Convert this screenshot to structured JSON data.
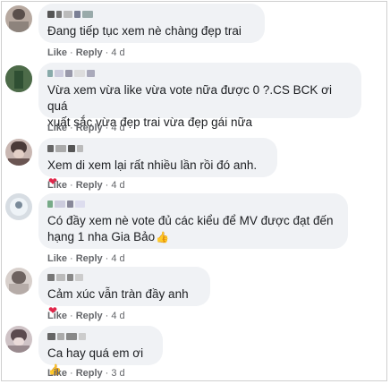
{
  "comments": [
    {
      "text": "Đang tiếp tục xem nè chàng đẹp trai",
      "emoji": "",
      "actions": {
        "like": "Like",
        "reply": "Reply",
        "time": "4 d"
      }
    },
    {
      "text": "Vừa xem vừa like vừa vote nữa được 0 ?.CS BCK ơi quá\nxuất sắc vừa đẹp trai vừa đẹp gái nữa",
      "emoji": "",
      "actions": {
        "like": "Like",
        "reply": "Reply",
        "time": "4 d"
      }
    },
    {
      "text": "Xem di xem lại rất nhiều lần rồi đó anh.",
      "emoji": "❤",
      "actions": {
        "like": "Like",
        "reply": "Reply",
        "time": "4 d"
      }
    },
    {
      "text": "Có đầy xem nè vote đủ các kiểu để MV được đạt đến\nhạng 1 nha Gia Bảo",
      "emoji": "👍",
      "actions": {
        "like": "Like",
        "reply": "Reply",
        "time": "4 d"
      }
    },
    {
      "text": "Cảm xúc vẫn tràn đầy anh ",
      "emoji": "❤",
      "actions": {
        "like": "Like",
        "reply": "Reply",
        "time": "4 d"
      }
    },
    {
      "text": "Ca hay quá em ơi ",
      "emoji": "👍",
      "actions": {
        "like": "Like",
        "reply": "Reply",
        "time": "3 d"
      }
    }
  ],
  "icons": {
    "heart": "heart-emoji-icon",
    "thumb": "thumbs-up-emoji-icon"
  },
  "colors": {
    "bubble": "#f0f2f5",
    "action": "#65676b",
    "heart": "#e0264a"
  }
}
